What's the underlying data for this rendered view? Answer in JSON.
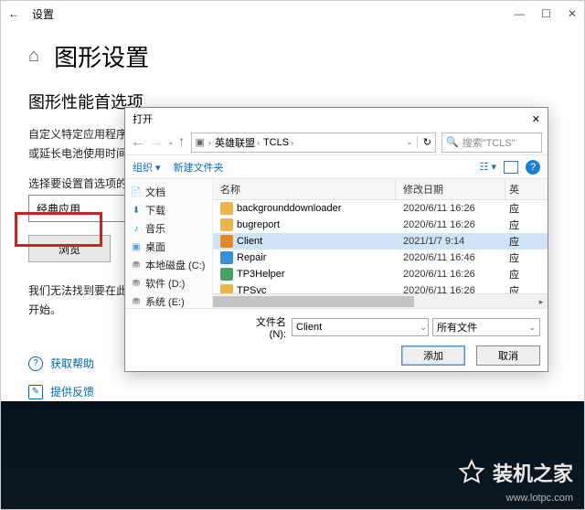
{
  "window": {
    "title": "设置",
    "min": "—",
    "max": "☐",
    "close": "✕",
    "back_icon": "←",
    "home_icon": "⌂"
  },
  "page": {
    "heading": "图形设置",
    "sub": "图形性能首选项",
    "desc1": "自定义特定应用程序的",
    "desc2": "或延长电池使用时间。",
    "select_label": "选择要设置首选项的应",
    "select_value": "经典应用",
    "browse": "浏览",
    "note": "我们无法找到要在此处",
    "note2": "开始。",
    "help": "获取帮助",
    "feedback": "提供反馈"
  },
  "dialog": {
    "title": "打开",
    "close": "✕",
    "nav_back": "←",
    "nav_fwd": "→",
    "nav_up": "↑",
    "refresh": "↻",
    "disk_icon": "▣",
    "crumb1": "英雄联盟",
    "crumb2": "TCLS",
    "search_ph": "搜索\"TCLS\"",
    "tool_org": "组织 ▾",
    "tool_new": "新建文件夹",
    "view_sel": "☷ ▾",
    "tree": [
      {
        "icon": "📄",
        "label": "文档",
        "color": "#3b7dc0"
      },
      {
        "icon": "⬇",
        "label": "下载",
        "color": "#2a7bd0"
      },
      {
        "icon": "♪",
        "label": "音乐",
        "color": "#1b7fce"
      },
      {
        "icon": "▣",
        "label": "桌面",
        "color": "#4aa3e0"
      },
      {
        "icon": "⛃",
        "label": "本地磁盘 (C:)",
        "color": "#777"
      },
      {
        "icon": "⛃",
        "label": "软件 (D:)",
        "color": "#777"
      },
      {
        "icon": "⛃",
        "label": "系统 (E:)",
        "color": "#777"
      }
    ],
    "cols": {
      "name": "名称",
      "date": "修改日期",
      "type": "英"
    },
    "rows": [
      {
        "name": "backgrounddownloader",
        "date": "2020/6/11 16:26",
        "type": "应",
        "sel": false,
        "color": "#edb54a"
      },
      {
        "name": "bugreport",
        "date": "2020/6/11 16:26",
        "type": "应",
        "sel": false,
        "color": "#edb54a"
      },
      {
        "name": "Client",
        "date": "2021/1/7 9:14",
        "type": "应",
        "sel": true,
        "color": "#e08a2a"
      },
      {
        "name": "Repair",
        "date": "2020/6/11 16:46",
        "type": "应",
        "sel": false,
        "color": "#3a90d8"
      },
      {
        "name": "TP3Helper",
        "date": "2020/6/11 16:26",
        "type": "应",
        "sel": false,
        "color": "#46a062"
      },
      {
        "name": "TPSvc",
        "date": "2020/6/11 16:26",
        "type": "应",
        "sel": false,
        "color": "#edb54a"
      }
    ],
    "fname_lbl": "文件名(N):",
    "fname_val": "Client",
    "ftype_val": "所有文件",
    "ok": "添加",
    "cancel": "取消"
  },
  "footer": {
    "brand": "装机之家",
    "site": "www.lotpc.com"
  }
}
